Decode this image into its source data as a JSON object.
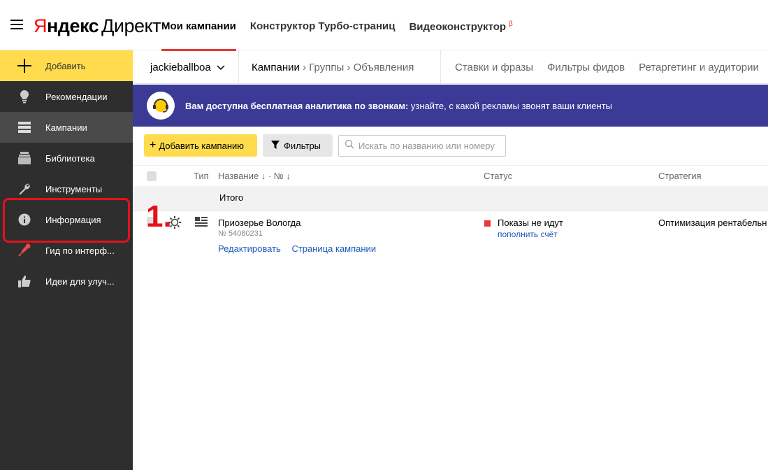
{
  "logo": {
    "ya_red": "Я",
    "ya_black": "ндекс",
    "product": "Директ"
  },
  "topnav": [
    {
      "label": "Мои кампании",
      "active": true
    },
    {
      "label": "Конструктор Турбо-страниц",
      "active": false
    },
    {
      "label": "Видеоконструктор",
      "active": false,
      "badge": "β"
    }
  ],
  "sidebar": {
    "add_label": "Добавить",
    "items": [
      {
        "label": "Рекомендации",
        "icon": "lightbulb-icon"
      },
      {
        "label": "Кампании",
        "icon": "list-icon",
        "active": true
      },
      {
        "label": "Библиотека",
        "icon": "library-icon"
      },
      {
        "label": "Инструменты",
        "icon": "wrench-icon"
      },
      {
        "label": "Информация",
        "icon": "info-icon"
      },
      {
        "label": "Гид по интерф...",
        "icon": "rocket-icon"
      },
      {
        "label": "Идеи для улуч...",
        "icon": "thumbs-up-icon"
      }
    ]
  },
  "subnav": {
    "account": "jackieballboa",
    "crumb_current": "Кампании",
    "crumb_groups": "Группы",
    "crumb_ads": "Объявления",
    "tabs": [
      "Ставки и фразы",
      "Фильтры фидов",
      "Ретаргетинг и аудитории"
    ]
  },
  "banner": {
    "bold": "Вам доступна бесплатная аналитика по звонкам:",
    "text": " узнайте, с какой рекламы звонят ваши клиенты"
  },
  "toolbar": {
    "add_campaign": "Добавить кампанию",
    "filters": "Фильтры",
    "search_placeholder": "Искать по названию или номеру"
  },
  "table": {
    "col_type": "Тип",
    "col_name": "Название ↓ · № ↓",
    "col_status": "Статус",
    "col_strategy": "Стратегия",
    "total_label": "Итого",
    "rows": [
      {
        "name": "Приозерье Вологда",
        "id": "№ 54080231",
        "edit": "Редактировать",
        "page": "Страница кампании",
        "status": "Показы не идут",
        "status_link": "пополнить счёт",
        "strategy": "Оптимизация рентабельн"
      }
    ]
  },
  "annotation": {
    "number": "1."
  },
  "colors": {
    "accent_yellow": "#ffdb4d",
    "banner_bg": "#3b3a96",
    "sidebar_bg": "#2e2e2e",
    "highlight_red": "#e3121b"
  }
}
